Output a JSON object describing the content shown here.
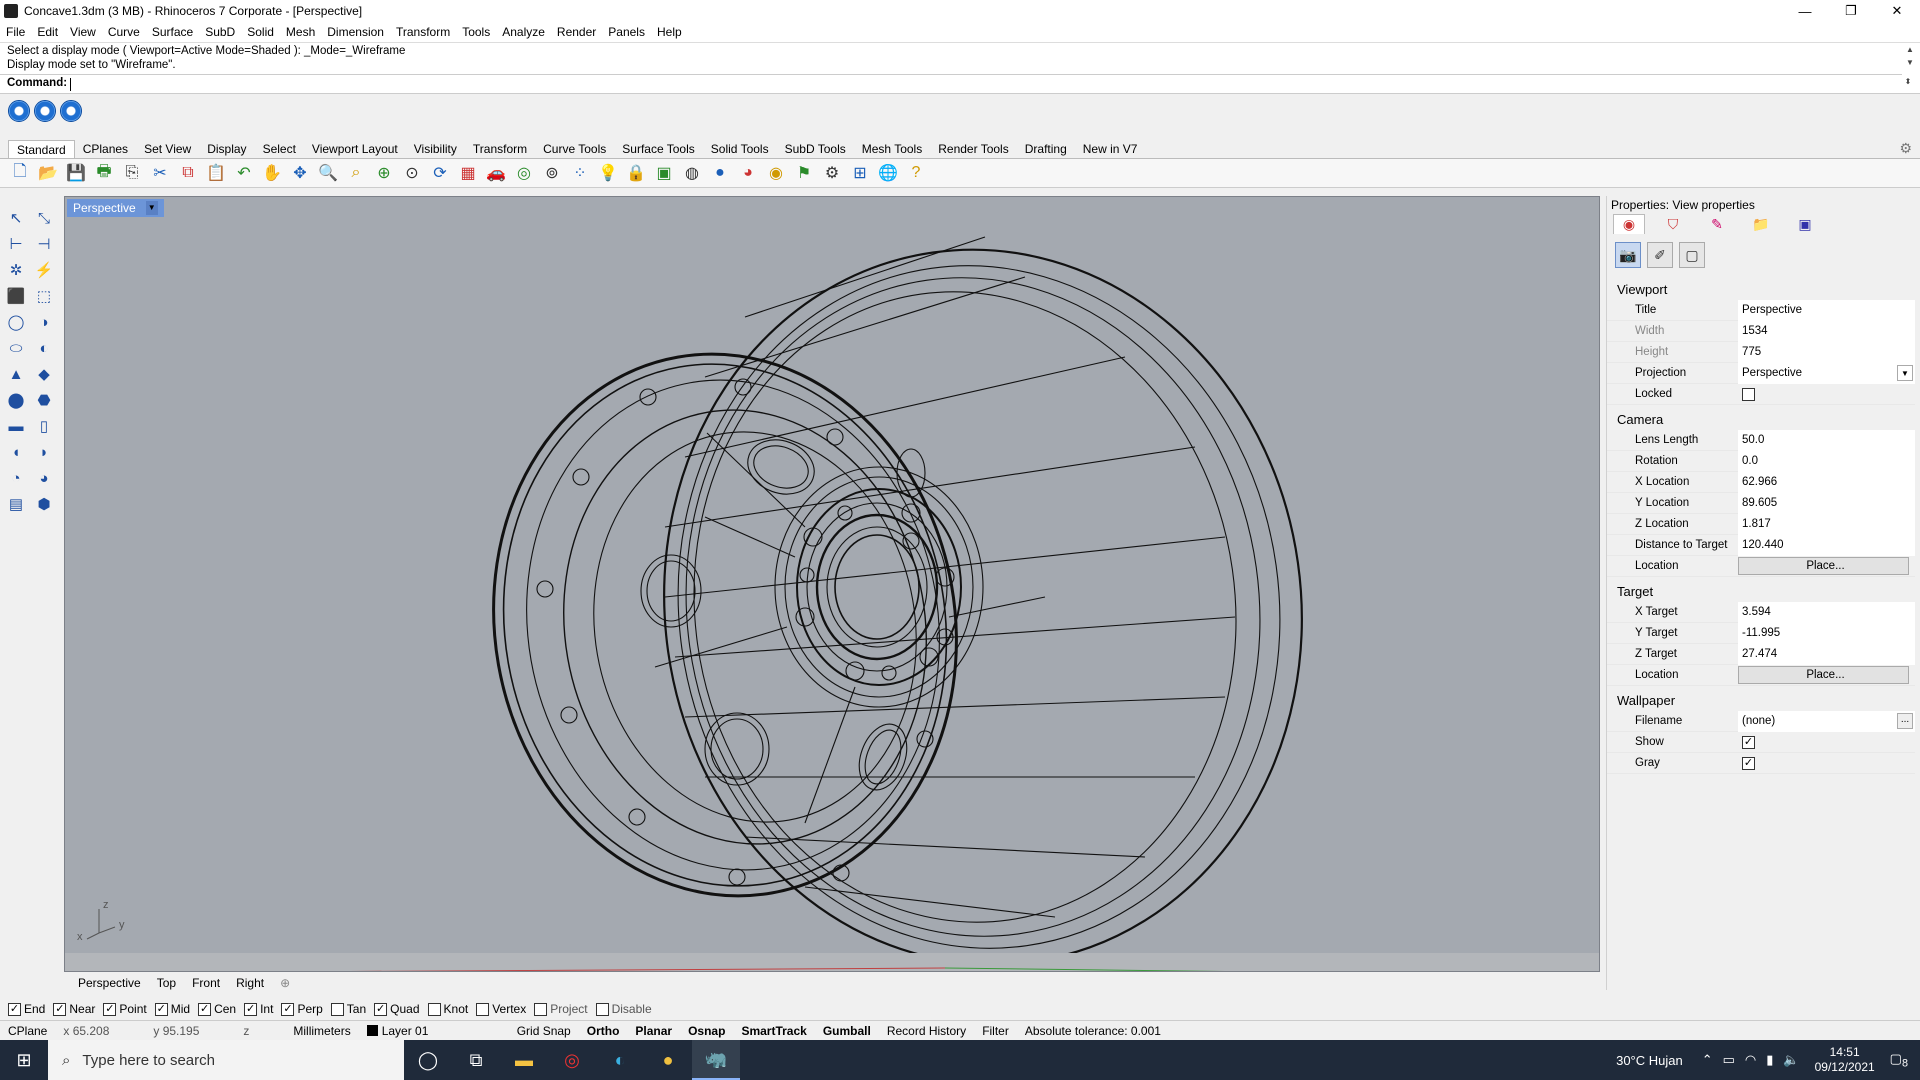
{
  "window": {
    "title": "Concave1.3dm (3 MB) - Rhinoceros 7 Corporate - [Perspective]",
    "minimize": "—",
    "restore": "❐",
    "close": "✕"
  },
  "menu": [
    "File",
    "Edit",
    "View",
    "Curve",
    "Surface",
    "SubD",
    "Solid",
    "Mesh",
    "Dimension",
    "Transform",
    "Tools",
    "Analyze",
    "Render",
    "Panels",
    "Help"
  ],
  "command": {
    "history": [
      "Select a display mode ( Viewport=Active  Mode=Shaded ): _Mode=_Wireframe",
      "Display mode set to \"Wireframe\"."
    ],
    "prompt": "Command:"
  },
  "toolbar_tabs": [
    "Standard",
    "CPlanes",
    "Set View",
    "Display",
    "Select",
    "Viewport Layout",
    "Visibility",
    "Transform",
    "Curve Tools",
    "Surface Tools",
    "Solid Tools",
    "SubD Tools",
    "Mesh Tools",
    "Render Tools",
    "Drafting",
    "New in V7"
  ],
  "toolbar_icons": [
    "new-icon",
    "open-icon",
    "save-icon",
    "print-icon",
    "import-icon",
    "cut-icon",
    "copy-icon",
    "paste-icon",
    "undo-icon",
    "pan-hand-icon",
    "move-view-icon",
    "zoom-icon",
    "zoom-window-icon",
    "zoom-extents-icon",
    "zoom-selected-icon",
    "rotate-view-icon",
    "four-viewports-icon",
    "car-icon",
    "named-view-icon",
    "cplane-icon",
    "select-points-icon",
    "light-bulb-icon",
    "lock-icon",
    "materials-icon",
    "color-wheel-icon",
    "shaded-sphere-icon",
    "rendered-sphere-icon",
    "render-icon",
    "options-icon",
    "gear-settings-icon",
    "dimension-icon",
    "globe-icon",
    "help-icon"
  ],
  "toolbar_glyphs": [
    "🗋",
    "📂",
    "💾",
    "🖶",
    "⎘",
    "✂",
    "⧉",
    "📋",
    "↶",
    "✋",
    "✥",
    "🔍",
    "⌕",
    "⊕",
    "⊙",
    "⟳",
    "▦",
    "🚗",
    "◎",
    "⊚",
    "⁘",
    "💡",
    "🔒",
    "▣",
    "◍",
    "●",
    "◕",
    "◉",
    "⚑",
    "⚙",
    "⊞",
    "🌐",
    "?"
  ],
  "left_tools": [
    "↖",
    "⤡",
    "⊢",
    "⊣",
    "✲",
    "⚡",
    "⬛",
    "⬚",
    "◯",
    "◑",
    "⬭",
    "◐",
    "▲",
    "◆",
    "⬤",
    "⬣",
    "▬",
    "▯",
    "◖",
    "◗",
    "◔",
    "◕",
    "▤",
    "⬢"
  ],
  "left_tool_names": [
    "select-arrow-icon",
    "point-icon",
    "line-icon",
    "polyline-icon",
    "curve-icon",
    "freeform-icon",
    "box-icon",
    "box-edit-icon",
    "sphere-icon",
    "sphere-edit-icon",
    "ellipsoid-icon",
    "ellipsoid-edit-icon",
    "cone-icon",
    "pyramid-icon",
    "cylinder-icon",
    "cylinder-edit-icon",
    "tube-icon",
    "pipe-icon",
    "torus-icon",
    "torus-edit-icon",
    "revolve-icon",
    "extrude-icon",
    "surface-icon",
    "mesh-icon"
  ],
  "viewport": {
    "label": "Perspective",
    "axis_x": "x",
    "axis_y": "y",
    "axis_z": "z"
  },
  "viewport_tabs": [
    "Perspective",
    "Top",
    "Front",
    "Right"
  ],
  "viewport_tab_add": "⊕",
  "panel": {
    "title": "Properties: View properties",
    "viewport_section": "Viewport",
    "camera_section": "Camera",
    "target_section": "Target",
    "wallpaper_section": "Wallpaper",
    "viewport_rows": [
      {
        "label": "Title",
        "value": "Perspective"
      },
      {
        "label": "Width",
        "value": "1534"
      },
      {
        "label": "Height",
        "value": "775"
      },
      {
        "label": "Projection",
        "value": "Perspective"
      },
      {
        "label": "Locked",
        "value": ""
      }
    ],
    "camera_rows": [
      {
        "label": "Lens Length",
        "value": "50.0"
      },
      {
        "label": "Rotation",
        "value": "0.0"
      },
      {
        "label": "X Location",
        "value": "62.966"
      },
      {
        "label": "Y Location",
        "value": "89.605"
      },
      {
        "label": "Z Location",
        "value": "1.817"
      },
      {
        "label": "Distance to Target",
        "value": "120.440"
      },
      {
        "label": "Location",
        "value": "Place..."
      }
    ],
    "target_rows": [
      {
        "label": "X Target",
        "value": "3.594"
      },
      {
        "label": "Y Target",
        "value": "-11.995"
      },
      {
        "label": "Z Target",
        "value": "27.474"
      },
      {
        "label": "Location",
        "value": "Place..."
      }
    ],
    "wallpaper_rows": [
      {
        "label": "Filename",
        "value": "(none)"
      },
      {
        "label": "Show",
        "value": "✓"
      },
      {
        "label": "Gray",
        "value": "✓"
      }
    ],
    "wallpaper_more": "..."
  },
  "osnap": [
    {
      "label": "End",
      "checked": true
    },
    {
      "label": "Near",
      "checked": true
    },
    {
      "label": "Point",
      "checked": true
    },
    {
      "label": "Mid",
      "checked": true
    },
    {
      "label": "Cen",
      "checked": true
    },
    {
      "label": "Int",
      "checked": true
    },
    {
      "label": "Perp",
      "checked": true
    },
    {
      "label": "Tan",
      "checked": false
    },
    {
      "label": "Quad",
      "checked": true
    },
    {
      "label": "Knot",
      "checked": false
    },
    {
      "label": "Vertex",
      "checked": false
    },
    {
      "label": "Project",
      "checked": false
    },
    {
      "label": "Disable",
      "checked": false
    }
  ],
  "status": {
    "cplane": "CPlane",
    "x": "x 65.208",
    "y": "y 95.195",
    "z": "z",
    "units": "Millimeters",
    "layer": "Layer 01",
    "grid_snap": "Grid Snap",
    "ortho": "Ortho",
    "planar": "Planar",
    "osnap": "Osnap",
    "smarttrack": "SmartTrack",
    "gumball": "Gumball",
    "record_history": "Record History",
    "filter": "Filter",
    "tolerance": "Absolute tolerance: 0.001"
  },
  "taskbar": {
    "search_placeholder": "Type here to search",
    "weather": "30°C  Hujan",
    "time": "14:51",
    "date": "09/12/2021",
    "notifications": "8"
  }
}
